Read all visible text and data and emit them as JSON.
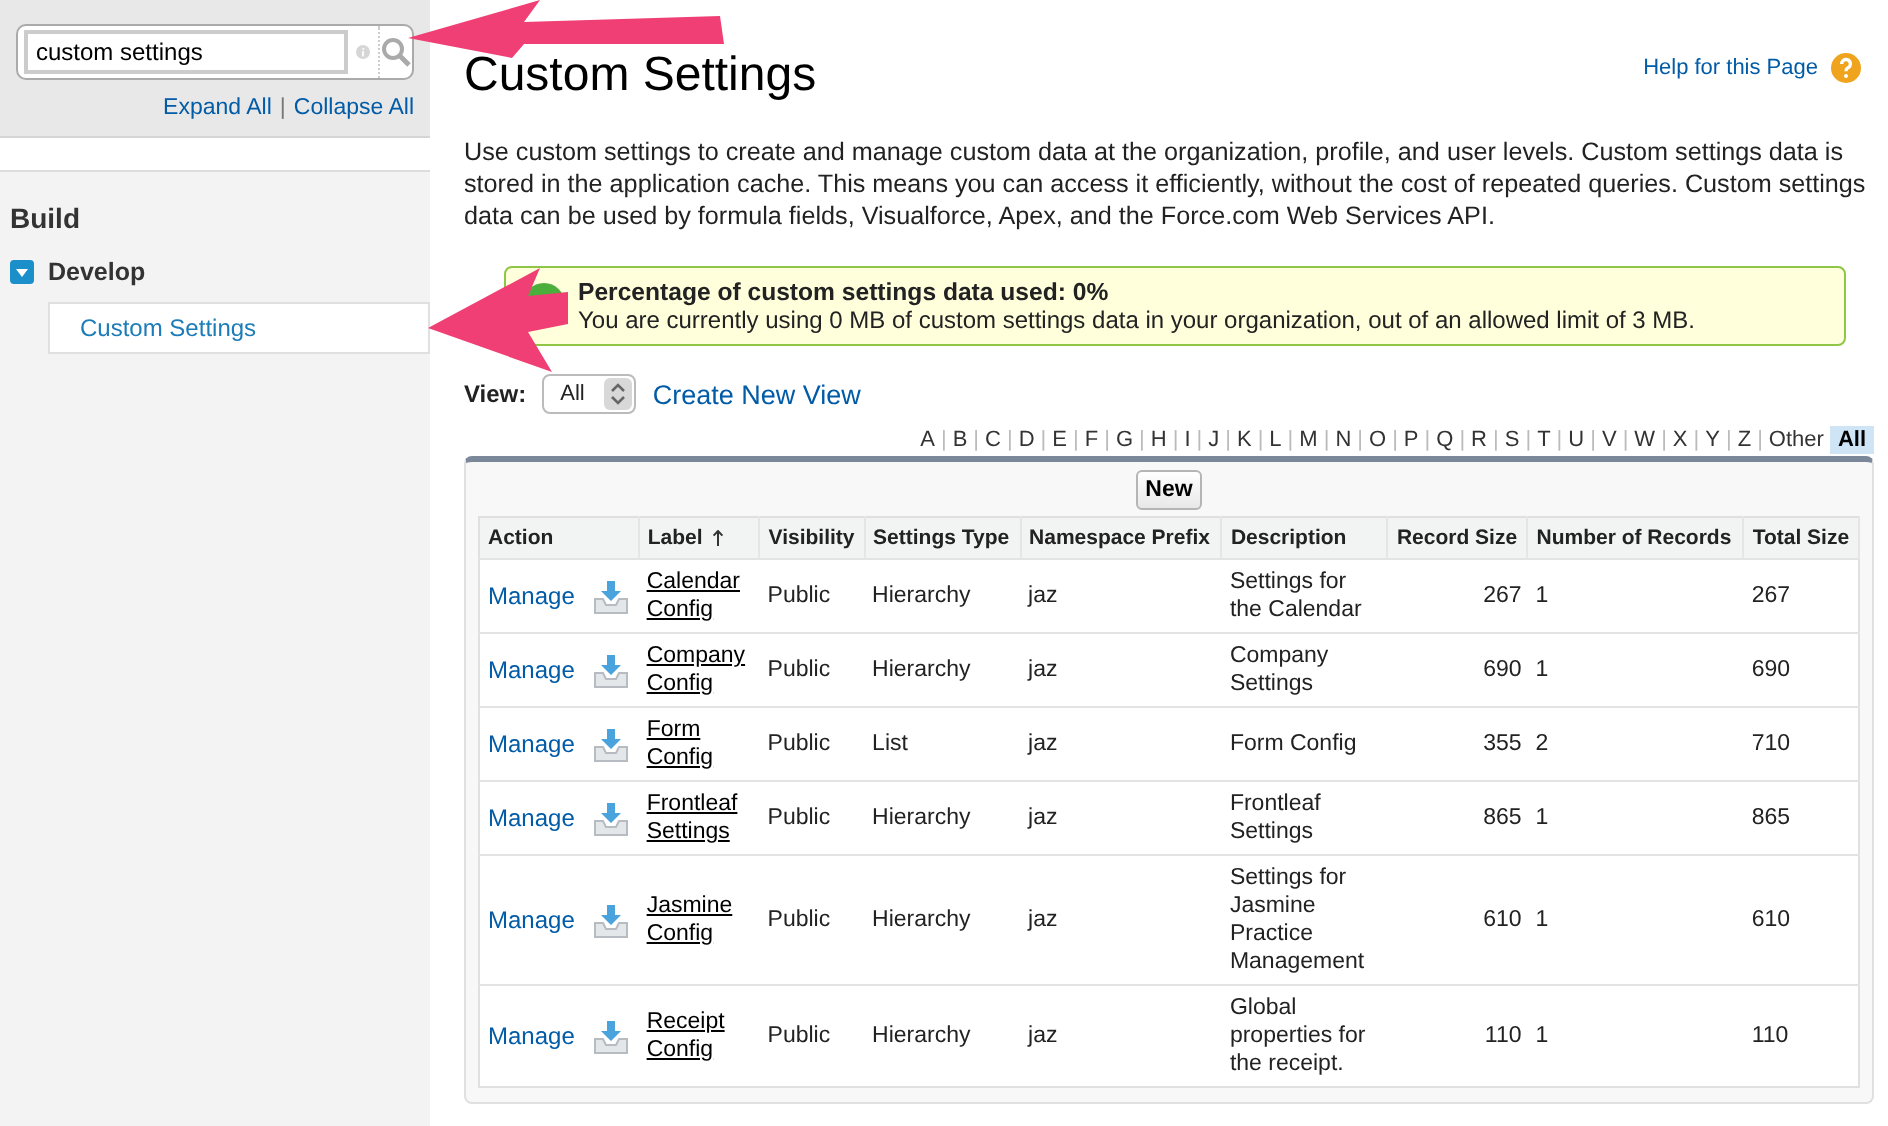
{
  "sidebar": {
    "search": {
      "value": "custom settings"
    },
    "expand_all": "Expand All",
    "separator": "|",
    "collapse_all": "Collapse All",
    "section": "Build",
    "tree": [
      {
        "label": "Develop",
        "expanded": true,
        "children": [
          {
            "label": "Custom Settings",
            "selected": true
          }
        ]
      }
    ]
  },
  "page": {
    "title": "Custom Settings",
    "help_link": "Help for this Page",
    "description": "Use custom settings to create and manage custom data at the organization, profile, and user levels. Custom settings data is stored in the application cache. This means you can access it efficiently, without the cost of repeated queries. Custom settings data can be used by formula fields, Visualforce, Apex, and the Force.com Web Services API.",
    "notice": {
      "title": "Percentage of custom settings data used: 0%",
      "message": "You are currently using 0 MB of custom settings data in your organization, out of an allowed limit of 3 MB."
    },
    "view": {
      "label": "View:",
      "value": "All",
      "create_link": "Create New View"
    },
    "letter_separator": "|",
    "letters": [
      {
        "label": "A",
        "selected": false
      },
      {
        "label": "B",
        "selected": false
      },
      {
        "label": "C",
        "selected": false
      },
      {
        "label": "D",
        "selected": false
      },
      {
        "label": "E",
        "selected": false
      },
      {
        "label": "F",
        "selected": false
      },
      {
        "label": "G",
        "selected": false
      },
      {
        "label": "H",
        "selected": false
      },
      {
        "label": "I",
        "selected": false
      },
      {
        "label": "J",
        "selected": false
      },
      {
        "label": "K",
        "selected": false
      },
      {
        "label": "L",
        "selected": false
      },
      {
        "label": "M",
        "selected": false
      },
      {
        "label": "N",
        "selected": false
      },
      {
        "label": "O",
        "selected": false
      },
      {
        "label": "P",
        "selected": false
      },
      {
        "label": "Q",
        "selected": false
      },
      {
        "label": "R",
        "selected": false
      },
      {
        "label": "S",
        "selected": false
      },
      {
        "label": "T",
        "selected": false
      },
      {
        "label": "U",
        "selected": false
      },
      {
        "label": "V",
        "selected": false
      },
      {
        "label": "W",
        "selected": false
      },
      {
        "label": "X",
        "selected": false
      },
      {
        "label": "Y",
        "selected": false
      },
      {
        "label": "Z",
        "selected": false
      },
      {
        "label": "Other",
        "selected": false
      },
      {
        "label": "All",
        "selected": true
      }
    ],
    "new_button": "New",
    "table": {
      "columns": [
        {
          "label": "Action",
          "sorted": false
        },
        {
          "label": "Label",
          "sorted": true
        },
        {
          "label": "Visibility",
          "sorted": false
        },
        {
          "label": "Settings Type",
          "sorted": false
        },
        {
          "label": "Namespace Prefix",
          "sorted": false
        },
        {
          "label": "Description",
          "sorted": false
        },
        {
          "label": "Record Size",
          "sorted": false
        },
        {
          "label": "Number of Records",
          "sorted": false
        },
        {
          "label": "Total Size",
          "sorted": false
        }
      ],
      "rows": [
        {
          "action": "Manage",
          "label": "Calendar Config",
          "visibility": "Public",
          "settings_type": "Hierarchy",
          "namespace_prefix": "jaz",
          "description": "Settings for the Calendar",
          "record_size": "267",
          "number_of_records": "1",
          "total_size": "267"
        },
        {
          "action": "Manage",
          "label": "Company Config",
          "visibility": "Public",
          "settings_type": "Hierarchy",
          "namespace_prefix": "jaz",
          "description": "Company Settings",
          "record_size": "690",
          "number_of_records": "1",
          "total_size": "690"
        },
        {
          "action": "Manage",
          "label": "Form Config",
          "visibility": "Public",
          "settings_type": "List",
          "namespace_prefix": "jaz",
          "description": "Form Config",
          "record_size": "355",
          "number_of_records": "2",
          "total_size": "710"
        },
        {
          "action": "Manage",
          "label": "Frontleaf Settings",
          "visibility": "Public",
          "settings_type": "Hierarchy",
          "namespace_prefix": "jaz",
          "description": "Frontleaf Settings",
          "record_size": "865",
          "number_of_records": "1",
          "total_size": "865"
        },
        {
          "action": "Manage",
          "label": "Jasmine Config",
          "visibility": "Public",
          "settings_type": "Hierarchy",
          "namespace_prefix": "jaz",
          "description": "Settings for Jasmine Practice Management",
          "record_size": "610",
          "number_of_records": "1",
          "total_size": "610"
        },
        {
          "action": "Manage",
          "label": "Receipt Config",
          "visibility": "Public",
          "settings_type": "Hierarchy",
          "namespace_prefix": "jaz",
          "description": "Global properties for the receipt.",
          "record_size": "110",
          "number_of_records": "1",
          "total_size": "110"
        }
      ]
    }
  }
}
